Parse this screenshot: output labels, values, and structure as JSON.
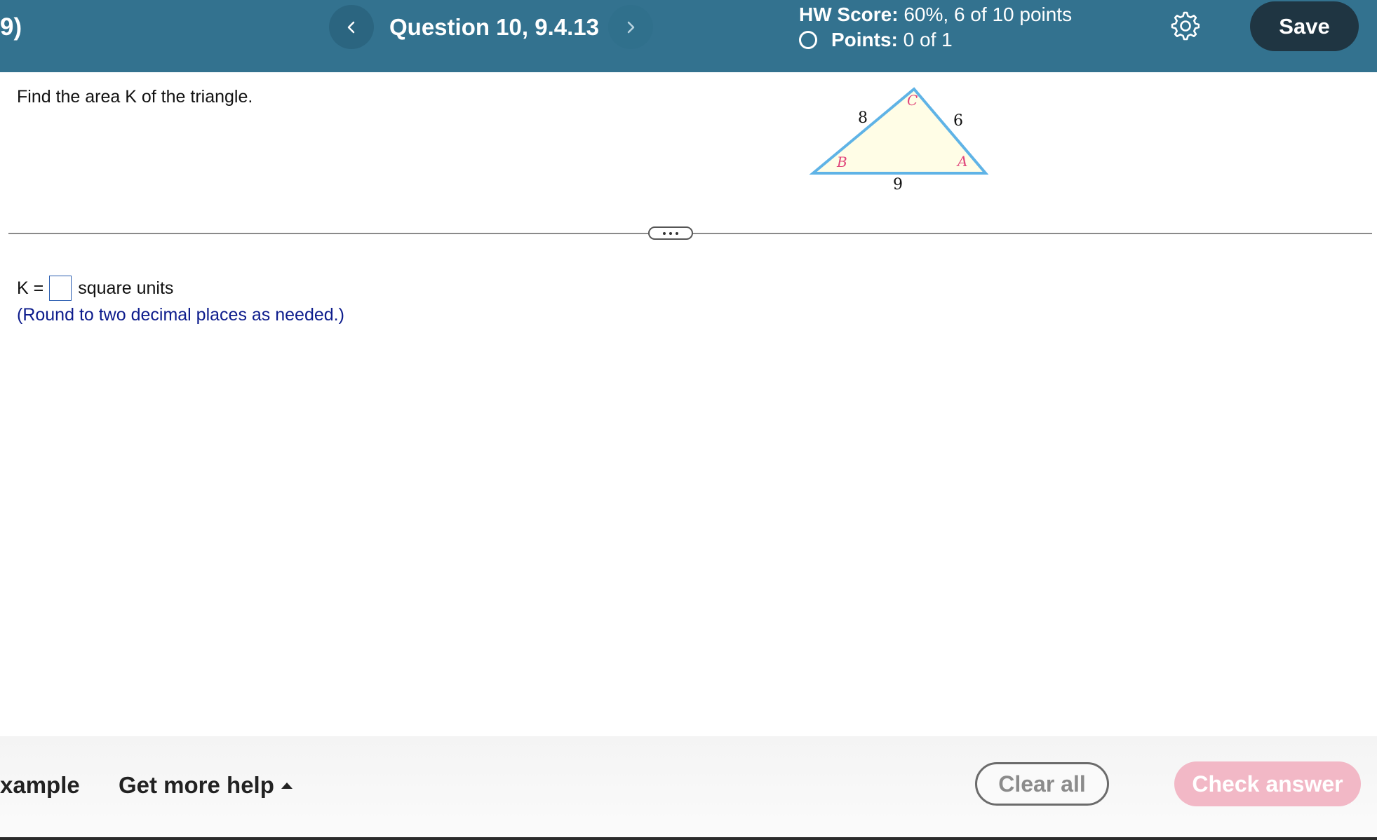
{
  "header": {
    "left_fragment": "9)",
    "question_title": "Question 10, 9.4.13",
    "hw_score_label": "HW Score:",
    "hw_score_value": "60%, 6 of 10 points",
    "points_label": "Points:",
    "points_value": "0 of 1",
    "save_label": "Save",
    "prev_icon": "chevron-left-icon",
    "next_icon": "chevron-right-icon",
    "settings_icon": "gear-icon"
  },
  "question": {
    "prompt": "Find the area K of the triangle.",
    "figure": {
      "side_BC": "8",
      "side_CA": "6",
      "side_BA": "9",
      "vertex_B": "B",
      "vertex_C": "C",
      "vertex_A": "A",
      "fill_color": "#fffde6",
      "stroke_color": "#5fb3e6",
      "vertex_label_color": "#e0457b"
    },
    "answer_prefix": "K =",
    "answer_value": "",
    "answer_suffix": "square units",
    "hint": "(Round to two decimal places as needed.)"
  },
  "footer": {
    "left_fragment": "xample",
    "help_label": "Get more help",
    "clear_label": "Clear all",
    "check_label": "Check answer"
  },
  "colors": {
    "header_bg": "#33728f",
    "save_bg": "#1f3542",
    "check_bg": "#f2b8c6",
    "hint_text": "#0d1c8c"
  }
}
